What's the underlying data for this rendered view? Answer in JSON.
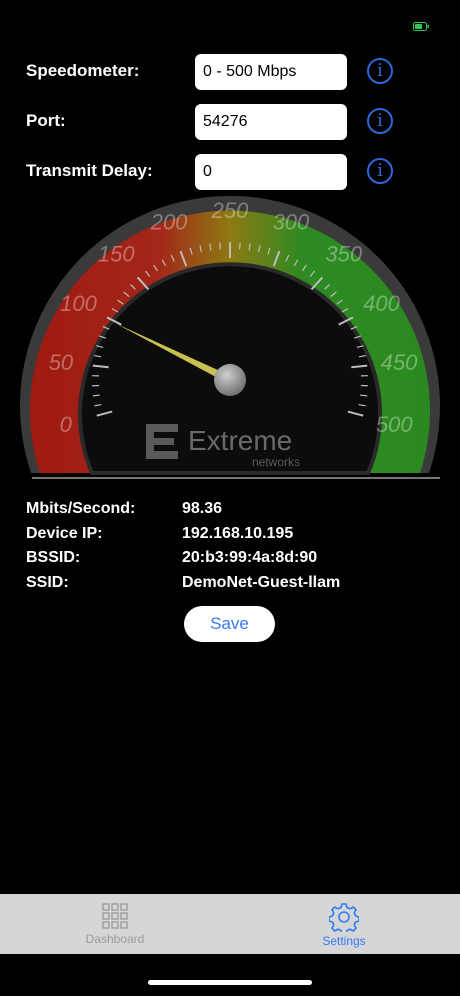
{
  "status": {
    "battery_color": "#34c759"
  },
  "settings": {
    "rows": [
      {
        "label": "Speedometer:",
        "value": "0 - 500 Mbps"
      },
      {
        "label": "Port:",
        "value": "54276"
      },
      {
        "label": "Transmit Delay:",
        "value": "0"
      }
    ],
    "info_glyph": "i"
  },
  "gauge": {
    "ticks": [
      "0",
      "50",
      "100",
      "150",
      "200",
      "250",
      "300",
      "350",
      "400",
      "450",
      "500"
    ],
    "min": 0,
    "max": 500,
    "reading": 98.36,
    "brand": "Extreme",
    "brand_sub": "networks",
    "zone_colors": {
      "low": "#b01c12",
      "mid": "#9a7d10",
      "high": "#2f8f22"
    }
  },
  "stats": [
    {
      "label": "Mbits/Second:",
      "value": "98.36"
    },
    {
      "label": "Device IP:",
      "value": "192.168.10.195"
    },
    {
      "label": "BSSID:",
      "value": "20:b3:99:4a:8d:90"
    },
    {
      "label": "SSID:",
      "value": "DemoNet-Guest-llam"
    }
  ],
  "save_label": "Save",
  "tabbar": {
    "tabs": [
      {
        "label": "Dashboard",
        "icon": "grid-icon",
        "active": false
      },
      {
        "label": "Settings",
        "icon": "gear-icon",
        "active": true
      }
    ],
    "active_color": "#2f7cf6",
    "inactive_color": "#9a9a9a"
  }
}
